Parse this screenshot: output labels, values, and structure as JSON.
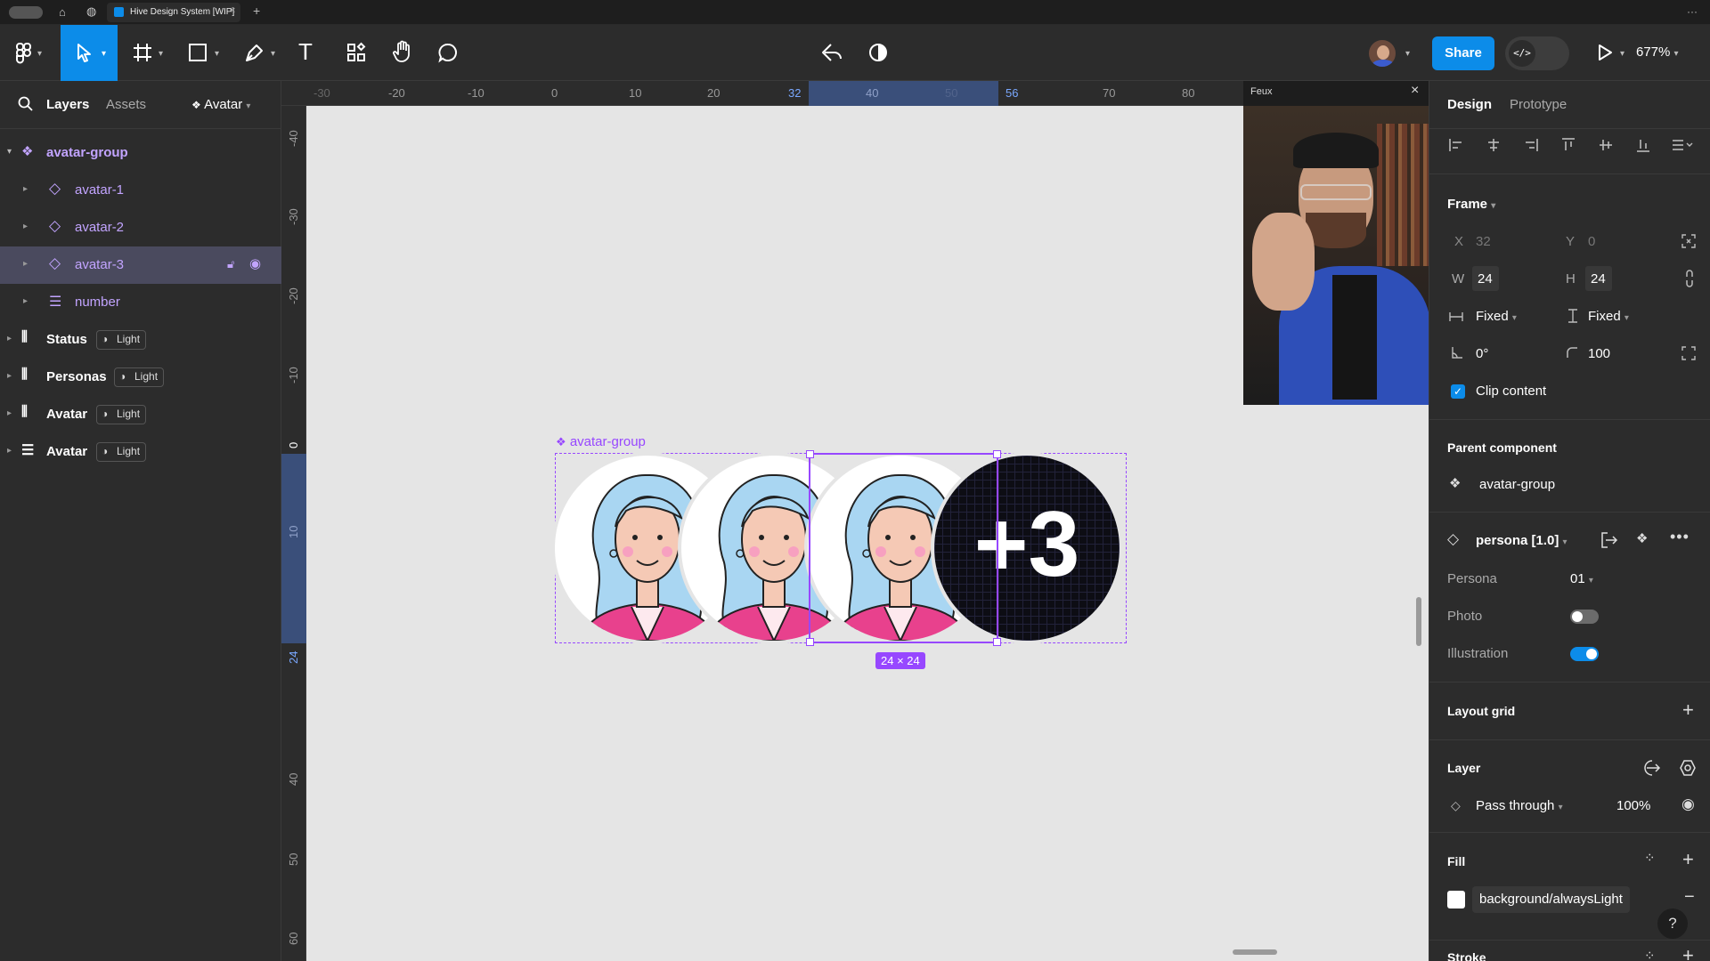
{
  "tabbar": {
    "tab_title": "Hive Design System [WIP]",
    "more": "···"
  },
  "toolbar": {
    "share_label": "Share",
    "zoom": "677%",
    "code_label": "</>"
  },
  "left": {
    "tabs": {
      "layers": "Layers",
      "assets": "Assets",
      "page": "Avatar"
    },
    "layers": [
      {
        "label": "avatar-group"
      },
      {
        "label": "avatar-1"
      },
      {
        "label": "avatar-2"
      },
      {
        "label": "avatar-3"
      },
      {
        "label": "number"
      },
      {
        "label": "Status",
        "badge": "Light"
      },
      {
        "label": "Personas",
        "badge": "Light"
      },
      {
        "label": "Avatar",
        "badge": "Light"
      },
      {
        "label": "Avatar",
        "badge": "Light"
      }
    ]
  },
  "canvas": {
    "ruler_x": [
      "-30",
      "-20",
      "-10",
      "0",
      "10",
      "20",
      "32",
      "40",
      "50",
      "56",
      "70",
      "80"
    ],
    "ruler_y": [
      "-40",
      "-30",
      "-20",
      "-10",
      "0",
      "10",
      "24",
      "40",
      "50",
      "60"
    ],
    "group_label": "avatar-group",
    "dimension_label": "24 × 24",
    "counter_text": "+3",
    "video_title": "Feux"
  },
  "right": {
    "tabs": {
      "design": "Design",
      "prototype": "Prototype"
    },
    "frame": {
      "title": "Frame",
      "x_label": "X",
      "x": "32",
      "y_label": "Y",
      "y": "0",
      "w_label": "W",
      "w": "24",
      "h_label": "H",
      "h": "24",
      "hsizing": "Fixed",
      "vsizing": "Fixed",
      "rotation": "0°",
      "radius": "100",
      "clip_content": "Clip content"
    },
    "parent": {
      "title": "Parent component",
      "name": "avatar-group"
    },
    "instance": {
      "name": "persona [1.0]",
      "persona_label": "Persona",
      "persona_value": "01",
      "photo_label": "Photo",
      "photo_on": false,
      "illustration_label": "Illustration",
      "illustration_on": true
    },
    "layout_grid": "Layout grid",
    "layer": {
      "title": "Layer",
      "blend": "Pass through",
      "opacity": "100%"
    },
    "fill": {
      "title": "Fill",
      "style": "background/alwaysLight"
    },
    "stroke": {
      "title": "Stroke"
    },
    "help": "?"
  },
  "colors": {
    "accent": "#0c8ce9",
    "purple": "#9747ff",
    "component": "#c2a4ff"
  }
}
